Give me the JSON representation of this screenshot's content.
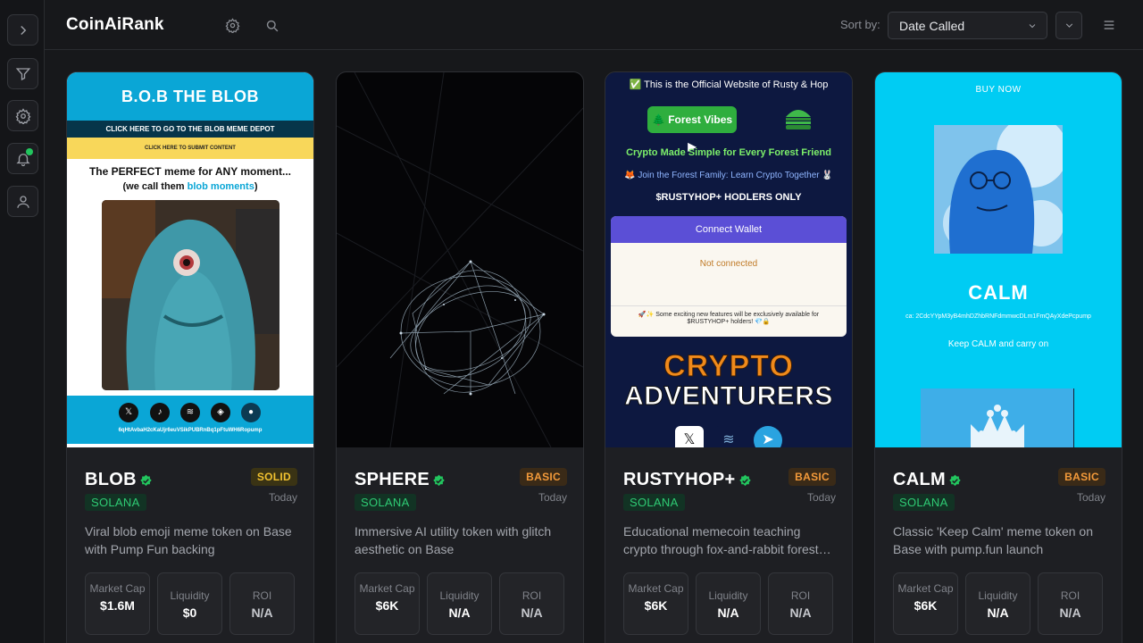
{
  "app": {
    "brand": "CoinAiRank"
  },
  "sidebar": {
    "items": [
      {
        "name": "expand",
        "icon": "chevron-right-icon"
      },
      {
        "name": "filter",
        "icon": "filter-icon"
      },
      {
        "name": "settings",
        "icon": "gear-icon"
      },
      {
        "name": "notifications",
        "icon": "bell-icon",
        "badge_color": "#22c55e"
      },
      {
        "name": "account",
        "icon": "user-icon"
      }
    ]
  },
  "header": {
    "sort_label": "Sort by:",
    "sort_value": "Date Called",
    "icons": [
      "gear-icon",
      "search-icon",
      "chevron-down-icon",
      "hamburger-menu-icon"
    ]
  },
  "cards": [
    {
      "name": "BLOB",
      "tier": "SOLID",
      "chain": "SOLANA",
      "date": "Today",
      "description": "Viral blob emoji meme token on Base with Pump Fun backing",
      "stats": [
        {
          "label": "Market Cap",
          "value": "$1.6M"
        },
        {
          "label": "Liquidity",
          "value": "$0"
        },
        {
          "label": "ROI",
          "value": "N/A"
        }
      ],
      "preview": {
        "title": "B.O.B THE BLOB",
        "bar1": "CLICK HERE TO GO TO THE BLOB MEME DEPOT",
        "bar2": "CLICK HERE TO SUBMIT CONTENT",
        "line1": "The PERFECT meme for ANY moment...",
        "line2_prefix": "(we call them ",
        "line2_highlight": "blob moments",
        "line2_suffix": ")",
        "ca": "6qHtAvbaH2cKaUjr6euVSikPUBRnBq1pFtuWH6Ropump"
      }
    },
    {
      "name": "SPHERE",
      "tier": "BASIC",
      "chain": "SOLANA",
      "date": "Today",
      "description": "Immersive AI utility token with glitch aesthetic on Base",
      "stats": [
        {
          "label": "Market Cap",
          "value": "$6K"
        },
        {
          "label": "Liquidity",
          "value": "N/A"
        },
        {
          "label": "ROI",
          "value": "N/A"
        }
      ]
    },
    {
      "name": "RUSTYHOP+",
      "tier": "BASIC",
      "chain": "SOLANA",
      "date": "Today",
      "description": "Educational memecoin teaching crypto through fox-and-rabbit forest adventures",
      "stats": [
        {
          "label": "Market Cap",
          "value": "$6K"
        },
        {
          "label": "Liquidity",
          "value": "N/A"
        },
        {
          "label": "ROI",
          "value": "N/A"
        }
      ],
      "preview": {
        "top": "✅ This is the Official Website of Rusty & Hop",
        "button": "🌲 Forest Vibes ▶",
        "green": "Crypto Made Simple for Every Forest Friend",
        "join": "🦊 Join the Forest Family: Learn Crypto Together 🐰",
        "hodl": "$RUSTYHOP+ HODLERS ONLY",
        "connect": "Connect Wallet",
        "not_connected": "Not connected",
        "note": "🚀✨ Some exciting new features will be exclusively available for $RUSTYHOP+ holders! 💎🔒",
        "crypto": "CRYPTO",
        "adventurers": "ADVENTURERS"
      }
    },
    {
      "name": "CALM",
      "tier": "BASIC",
      "chain": "SOLANA",
      "date": "Today",
      "description": "Classic 'Keep Calm' meme token on Base with pump.fun launch",
      "stats": [
        {
          "label": "Market Cap",
          "value": "$6K"
        },
        {
          "label": "Liquidity",
          "value": "N/A"
        },
        {
          "label": "ROI",
          "value": "N/A"
        }
      ],
      "preview": {
        "buy": "BUY NOW",
        "title": "CALM",
        "ca": "ca: 2CdcYYpM3yB4mhDZhbRNFdmmwcDLm1FmQAyXdePcpump",
        "keep": "Keep CALM and carry on"
      }
    }
  ],
  "colors": {
    "accent_green": "#2fcb74",
    "tier_basic": "#f39a3a",
    "tier_solid": "#f2c230",
    "verified": "#22c55e"
  }
}
